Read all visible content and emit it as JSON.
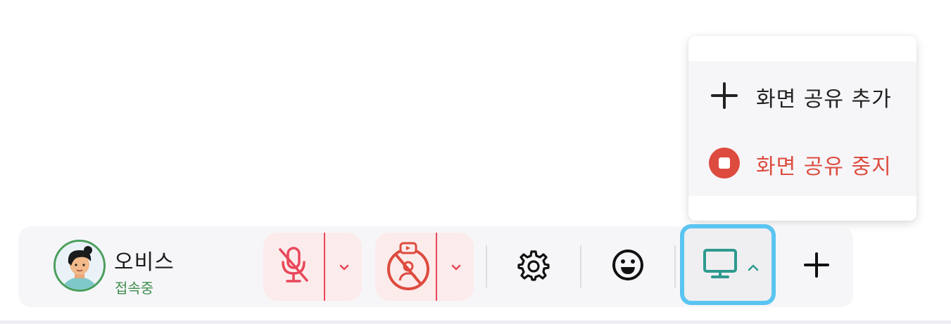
{
  "user": {
    "name": "오비스",
    "status": "접속중"
  },
  "toolbar": {
    "mic_icon": "mic-off-icon",
    "camera_icon": "camera-off-icon",
    "settings_icon": "gear-icon",
    "emoji_icon": "smile-icon",
    "share_icon": "monitor-icon",
    "add_icon": "plus-icon"
  },
  "share_menu": {
    "items": [
      {
        "label": "화면 공유 추가",
        "icon": "plus-icon",
        "color": "#222222"
      },
      {
        "label": "화면 공유 중지",
        "icon": "stop-circle-icon",
        "color": "#dd4b3e"
      }
    ]
  },
  "colors": {
    "danger": "#e8475a",
    "danger_bg": "#fcebeb",
    "online": "#3e8f4c",
    "share_accent": "#5bc4f0",
    "monitor": "#2e9a8e"
  }
}
